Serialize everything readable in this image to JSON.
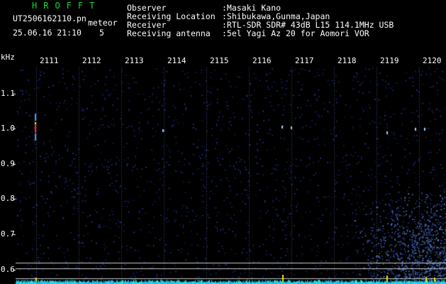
{
  "app": {
    "title": "HROFFT",
    "filename": "UT2506162110.pn",
    "tag": "meteor",
    "datetime": "25.06.16 21:10",
    "counter": "5"
  },
  "info": [
    {
      "label": "Observer",
      "value": ":Masaki Kano"
    },
    {
      "label": "Receiving Location",
      "value": ":Shibukawa,Gunma,Japan"
    },
    {
      "label": "Receiver",
      "value": ":RTL-SDR SDR# 43dB L15 114.1MHz USB"
    },
    {
      "label": "Receiving antenna",
      "value": ":5el Yagi Az 20 for Aomori VOR"
    }
  ],
  "y_axis": {
    "unit": "kHz",
    "ticks": [
      "1.1",
      "1.0",
      "0.9",
      "0.8",
      "0.7",
      "0.6"
    ]
  },
  "x_axis": {
    "ticks": [
      "2111",
      "2112",
      "2113",
      "2114",
      "2115",
      "2116",
      "2117",
      "2118",
      "2119",
      "2120"
    ]
  },
  "colors": {
    "background": "#000000",
    "noise": "#1a2a8c",
    "signal": "#e6e600",
    "grid": "#ffffff",
    "title": "#19d82e"
  }
}
